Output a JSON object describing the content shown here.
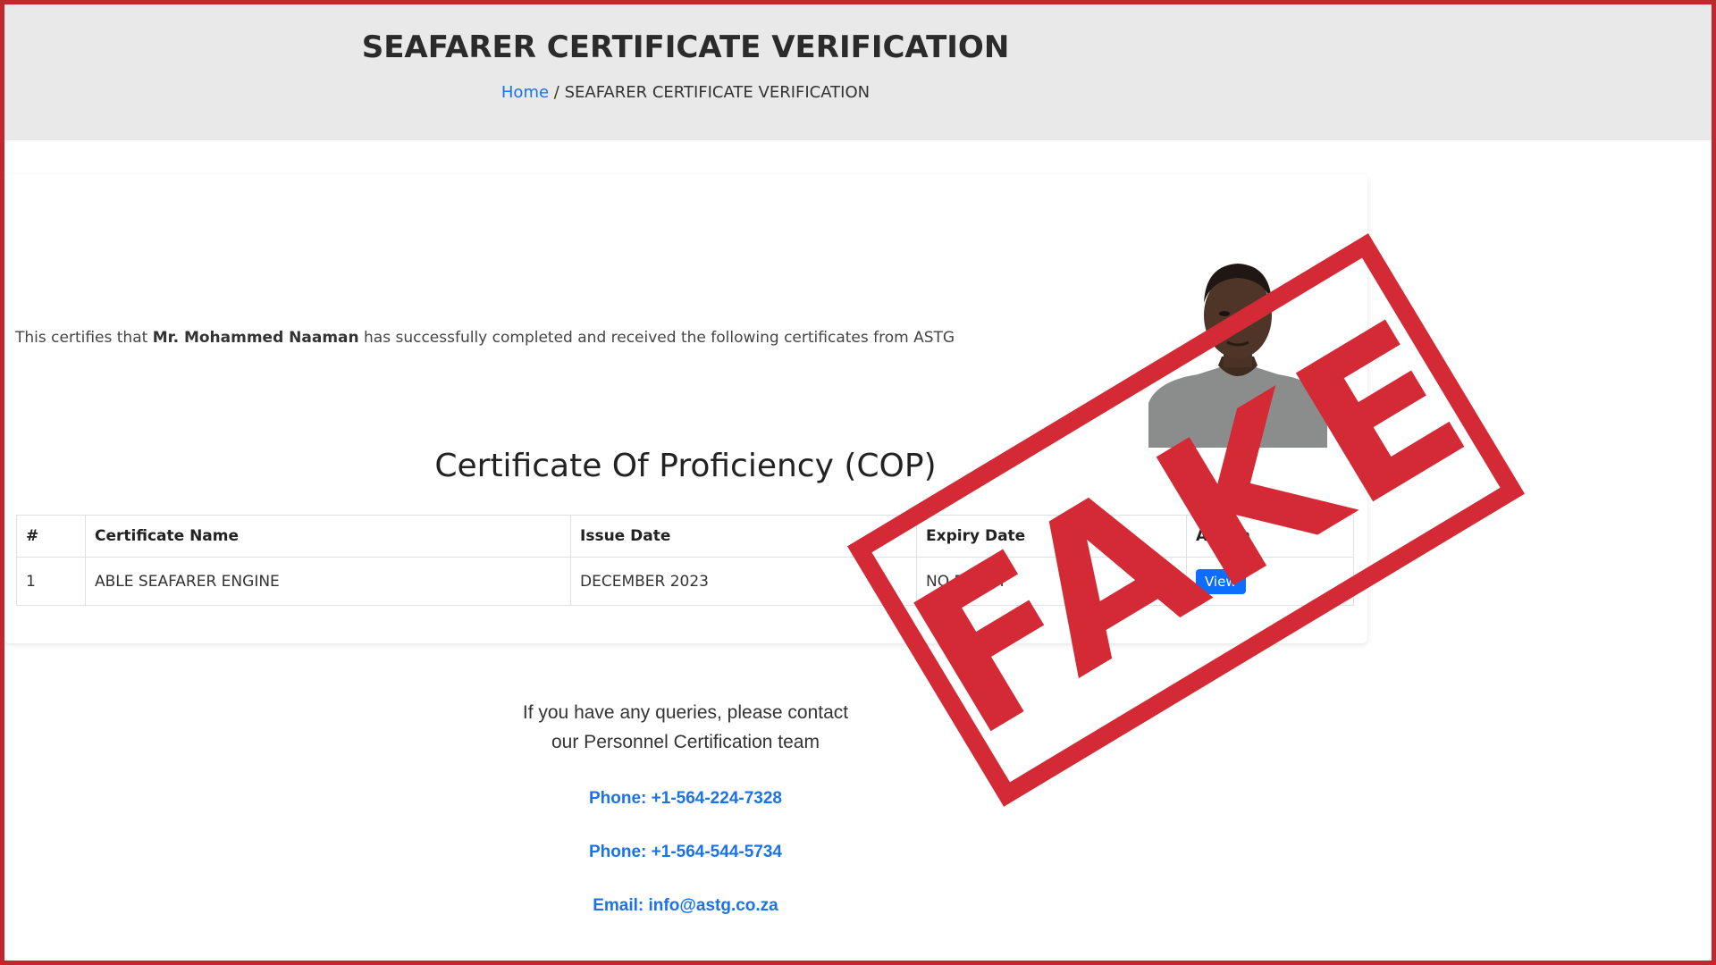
{
  "header": {
    "title": "SEAFARER CERTIFICATE VERIFICATION",
    "breadcrumb_home": "Home",
    "breadcrumb_separator": "/",
    "breadcrumb_current": "SEAFARER CERTIFICATE VERIFICATION"
  },
  "certification": {
    "prefix": "This certifies that",
    "name": "Mr. Mohammed Naaman",
    "suffix": "has successfully completed and received the following certificates from ASTG"
  },
  "section": {
    "title": "Certificate Of Proficiency (COP)"
  },
  "table": {
    "headers": [
      "#",
      "Certificate Name",
      "Issue Date",
      "Expiry Date",
      "Action"
    ],
    "rows": [
      {
        "index": "1",
        "name": "ABLE SEAFARER ENGINE",
        "issue_date": "DECEMBER 2023",
        "expiry": "NO EXPIRY",
        "action": "View"
      }
    ]
  },
  "contact": {
    "line1": "If you have any queries, please contact",
    "line2": "our Personnel Certification team",
    "phone1": "Phone: +1-564-224-7328",
    "phone2": "Phone: +1-564-544-5734",
    "email": "Email: info@astg.co.za"
  },
  "stamp": {
    "text": "FAKE",
    "color": "#d42a35"
  },
  "colors": {
    "frame_border": "#c1272d",
    "header_bg": "#e9e9ea",
    "link": "#1a73e8",
    "button": "#0d6efd"
  }
}
